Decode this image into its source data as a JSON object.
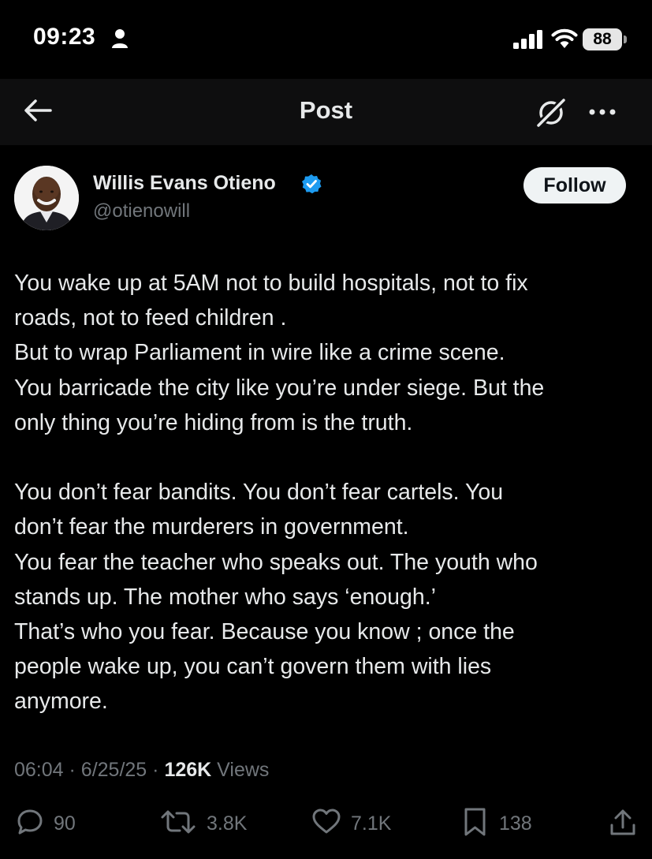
{
  "status_bar": {
    "time": "09:23",
    "battery": "88"
  },
  "nav": {
    "title": "Post"
  },
  "author": {
    "name": "Willis Evans Otieno",
    "handle": "@otienowill",
    "verified": true,
    "follow_label": "Follow"
  },
  "post": {
    "lines": [
      "You wake up at 5AM not to build hospitals, not to fix",
      "roads, not to feed children .",
      "But to wrap Parliament in wire like a crime scene.",
      "You barricade the city like you’re under siege. But the",
      "only thing you’re hiding from is the truth.",
      "",
      "You don’t fear bandits. You don’t fear cartels. You",
      "don’t fear the murderers in government.",
      "You fear the teacher who speaks out. The youth who",
      "stands up. The mother who says ‘enough.’",
      "That’s who you fear. Because you know ; once the",
      "people wake up, you can’t govern them with lies",
      "anymore."
    ],
    "time": "06:04",
    "date": "6/25/25",
    "views_count": "126K",
    "views_label": "Views"
  },
  "actions": {
    "replies": "90",
    "reposts": "3.8K",
    "likes": "7.1K",
    "bookmarks": "138"
  },
  "colors": {
    "background": "#000000",
    "text": "#e7e9ea",
    "muted": "#71767b",
    "verified": "#1d9bf0"
  }
}
